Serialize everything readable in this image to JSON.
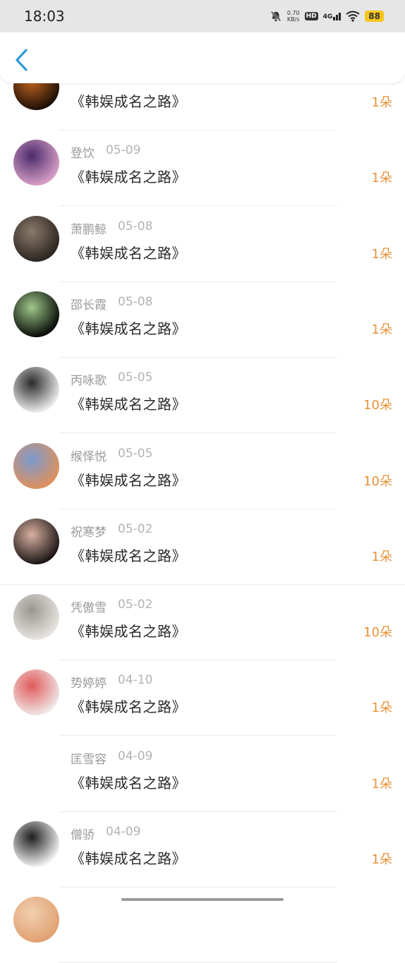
{
  "status_bar": {
    "time": "18:03",
    "net_speed_value": "0.70",
    "net_speed_unit": "KB/s",
    "hd": "HD",
    "network": "4G",
    "battery": "88"
  },
  "header": {
    "back_icon": "chevron-left-icon"
  },
  "records": [
    {
      "name": "",
      "date": "",
      "book": "《韩娱成名之路》",
      "amount": "1朵",
      "avatar_colors": [
        "#1a0d05",
        "#c4661f"
      ]
    },
    {
      "name": "登饮",
      "date": "05-09",
      "book": "《韩娱成名之路》",
      "amount": "1朵",
      "avatar_colors": [
        "#d9a0c8",
        "#4a2a6a"
      ]
    },
    {
      "name": "萧鹏鲸",
      "date": "05-08",
      "book": "《韩娱成名之路》",
      "amount": "1朵",
      "avatar_colors": [
        "#2a2420",
        "#8a7a6a"
      ]
    },
    {
      "name": "邵长霞",
      "date": "05-08",
      "book": "《韩娱成名之路》",
      "amount": "1朵",
      "avatar_colors": [
        "#050805",
        "#9ec88a"
      ]
    },
    {
      "name": "丙咏歌",
      "date": "05-05",
      "book": "《韩娱成名之路》",
      "amount": "10朵",
      "avatar_colors": [
        "#f0f0f0",
        "#2a2a2a"
      ]
    },
    {
      "name": "缑怿悦",
      "date": "05-05",
      "book": "《韩娱成名之路》",
      "amount": "10朵",
      "avatar_colors": [
        "#e0905a",
        "#7a9ad0"
      ]
    },
    {
      "name": "祝寒梦",
      "date": "05-02",
      "book": "《韩娱成名之路》",
      "amount": "1朵",
      "avatar_colors": [
        "#1a1414",
        "#d8b0a0"
      ]
    },
    {
      "name": "凭傲雪",
      "date": "05-02",
      "book": "《韩娱成名之路》",
      "amount": "10朵",
      "avatar_colors": [
        "#e8e6e2",
        "#9a9690"
      ]
    },
    {
      "name": "势婷婷",
      "date": "04-10",
      "book": "《韩娱成名之路》",
      "amount": "1朵",
      "avatar_colors": [
        "#f0e8e8",
        "#e05a5a"
      ]
    },
    {
      "name": "匡雪容",
      "date": "04-09",
      "book": "《韩娱成名之路》",
      "amount": "1朵",
      "avatar_colors": [
        "#ffffff",
        "#ffffff"
      ]
    },
    {
      "name": "僧骄",
      "date": "04-09",
      "book": "《韩娱成名之路》",
      "amount": "1朵",
      "avatar_colors": [
        "#f5f5f5",
        "#1e1e1e"
      ]
    },
    {
      "name": "",
      "date": "",
      "book": "",
      "amount": "",
      "avatar_colors": [
        "#e0a070",
        "#f0d0b0"
      ]
    }
  ]
}
